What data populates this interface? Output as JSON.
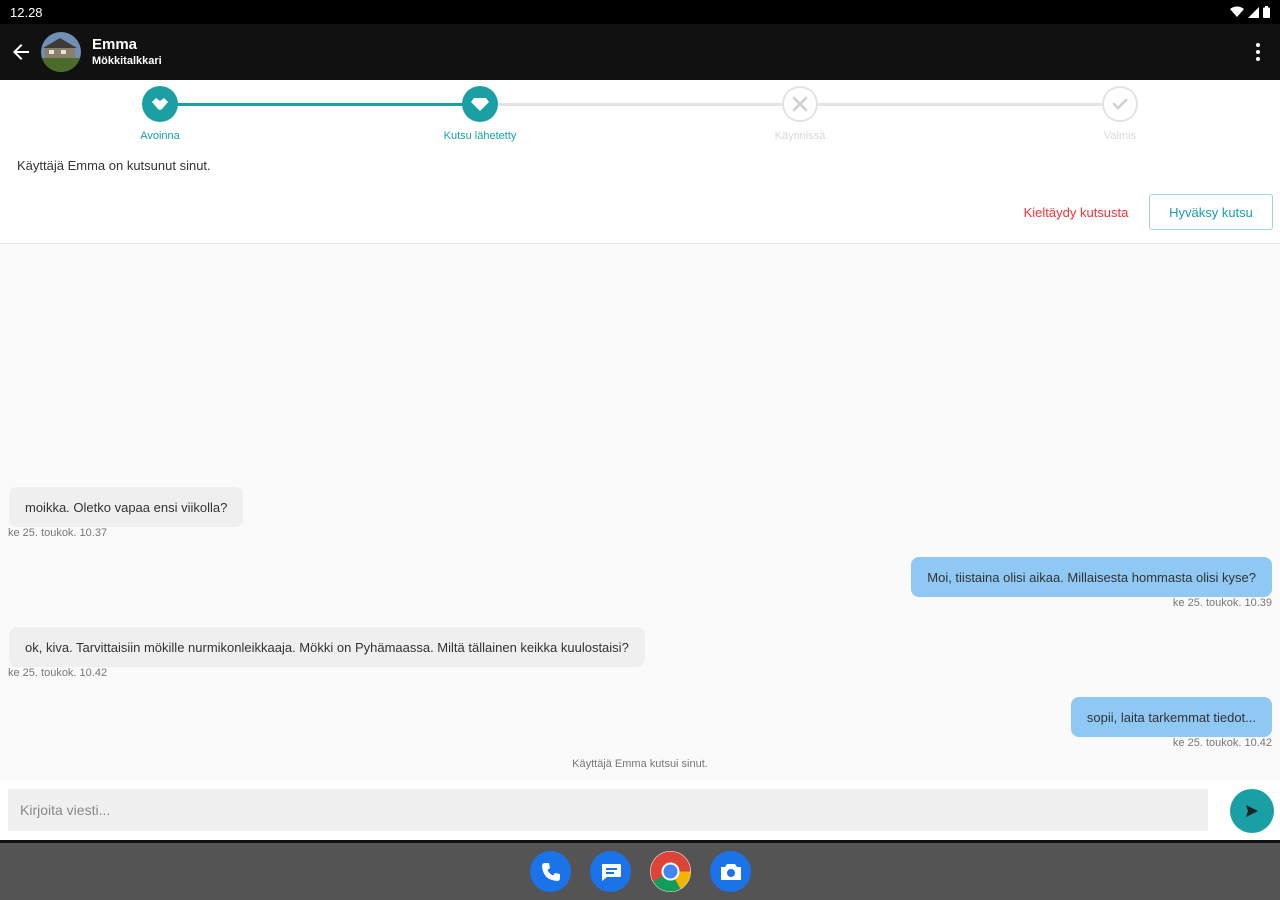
{
  "status_bar": {
    "time": "12.28"
  },
  "app_bar": {
    "title": "Emma",
    "subtitle": "Mökkitalkkari"
  },
  "stepper": {
    "steps": [
      {
        "label": "Avoinna",
        "state": "done"
      },
      {
        "label": "Kutsu lähetetty",
        "state": "done"
      },
      {
        "label": "Käynnissä",
        "state": "todo"
      },
      {
        "label": "Valmis",
        "state": "todo"
      }
    ]
  },
  "invitation": {
    "text": "Käyttäjä Emma on kutsunut sinut.",
    "decline_label": "Kieltäydy kutsusta",
    "accept_label": "Hyväksy kutsu"
  },
  "messages": [
    {
      "direction": "in",
      "text": "moikka. Oletko vapaa ensi viikolla?",
      "time": "ke 25. toukok. 10.37"
    },
    {
      "direction": "out",
      "text": "Moi, tiistaina olisi aikaa. Millaisesta hommasta olisi kyse?",
      "time": "ke 25. toukok. 10.39"
    },
    {
      "direction": "in",
      "text": "ok, kiva. Tarvittaisiin mökille nurmikonleikkaaja. Mökki on Pyhämaassa. Miltä tällainen keikka kuulostaisi?",
      "time": "ke 25. toukok. 10.42"
    },
    {
      "direction": "out",
      "text": "sopii, laita tarkemmat tiedot...",
      "time": "ke 25. toukok. 10.42"
    }
  ],
  "system_note": "Käyttäjä Emma kutsui sinut.",
  "compose": {
    "placeholder": "Kirjoita viesti..."
  },
  "colors": {
    "accent": "#1aa0a4",
    "outgoing_bubble": "#8fc8f2",
    "incoming_bubble": "#efefef",
    "decline": "#f0353a",
    "app_bar": "#111111"
  },
  "dock": [
    "phone-icon",
    "messages-icon",
    "chrome-icon",
    "camera-icon"
  ]
}
